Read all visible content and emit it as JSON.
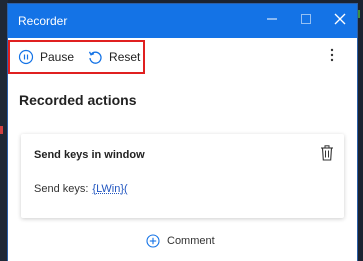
{
  "window": {
    "title": "Recorder",
    "accent_color": "#1473e6"
  },
  "titlebar_buttons": {
    "minimize_icon": "minimize-icon",
    "maximize_icon": "maximize-icon",
    "close_icon": "close-icon"
  },
  "toolbar": {
    "pause_label": "Pause",
    "reset_label": "Reset",
    "more_icon": "more-vertical-icon",
    "highlight_color": "#e02020"
  },
  "main": {
    "section_title": "Recorded actions",
    "actions": [
      {
        "title": "Send keys in window",
        "detail_label": "Send keys:",
        "detail_value": "{LWin}(",
        "delete_icon": "trash-icon"
      }
    ],
    "comment_label": "Comment"
  }
}
